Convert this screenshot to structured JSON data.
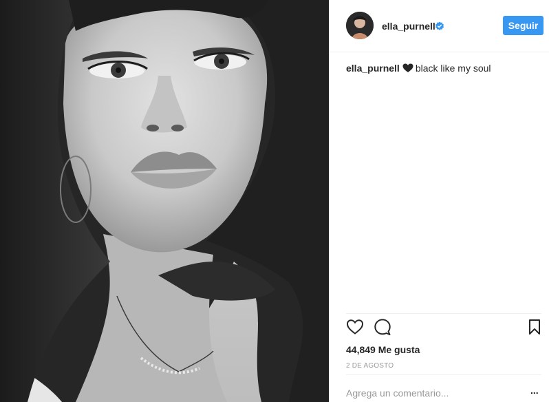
{
  "post": {
    "image_alt": "Black and white close-up selfie photo",
    "author": {
      "username": "ella_purnell",
      "verified": true,
      "avatar_icon": "profile-photo"
    },
    "follow_label": "Seguir",
    "caption": {
      "username": "ella_purnell",
      "emoji": "black-heart",
      "text": "black like my soul"
    },
    "actions": {
      "like_icon": "heart-outline-icon",
      "comment_icon": "comment-bubble-icon",
      "save_icon": "bookmark-icon"
    },
    "likes_text": "44,849 Me gusta",
    "date_text": "2 de agosto",
    "comment_placeholder": "Agrega un comentario...",
    "more_label": "..."
  },
  "colors": {
    "accent": "#3897f0",
    "text": "#262626",
    "muted": "#999999",
    "divider": "#efefef"
  }
}
